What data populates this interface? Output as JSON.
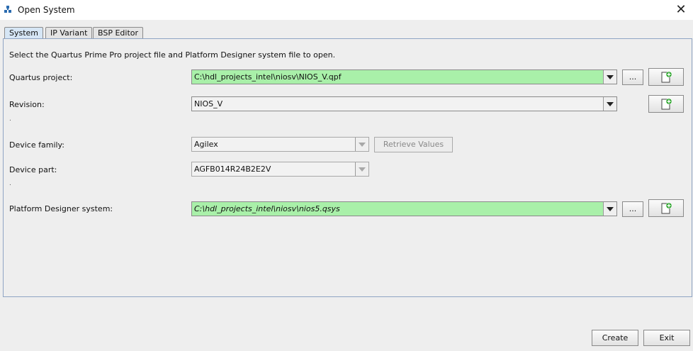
{
  "window": {
    "title": "Open System",
    "close_symbol": "✕"
  },
  "tabs": [
    {
      "label": "System",
      "active": true
    },
    {
      "label": "IP Variant",
      "active": false
    },
    {
      "label": "BSP Editor",
      "active": false
    }
  ],
  "form": {
    "instruction": "Select the Quartus Prime Pro project file and Platform Designer system file to open.",
    "quartus_project": {
      "label": "Quartus project:",
      "value": "C:\\hdl_projects_intel\\niosv\\NIOS_V.qpf",
      "browse_label": "..."
    },
    "revision": {
      "label": "Revision:",
      "value": "NIOS_V"
    },
    "separator1": ".",
    "device_family": {
      "label": "Device family:",
      "value": "Agilex",
      "retrieve_label": "Retrieve Values"
    },
    "device_part": {
      "label": "Device part:",
      "value": "AGFB014R24B2E2V"
    },
    "separator2": ".",
    "platform_designer": {
      "label": "Platform Designer system:",
      "value": "C:\\hdl_projects_intel\\niosv\\nios5.qsys",
      "browse_label": "..."
    }
  },
  "footer": {
    "create_label": "Create",
    "exit_label": "Exit"
  },
  "colors": {
    "valid_field": "#a9f0a9",
    "active_tab": "#d6e6f5",
    "panel_border": "#8fa5c4"
  }
}
